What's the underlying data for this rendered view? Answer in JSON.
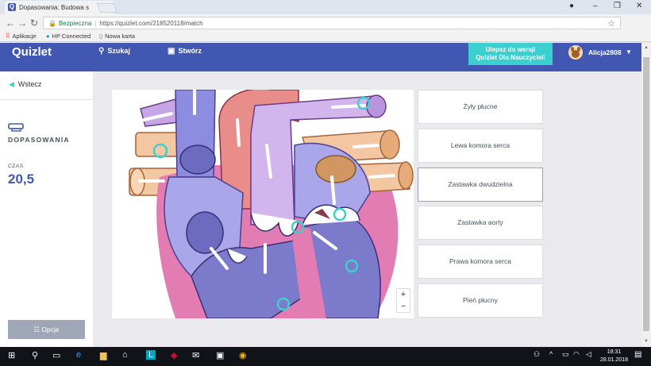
{
  "browser": {
    "tab_title": "Dopasowania: Budowa s",
    "tab_close": "×",
    "secure_label": "Bezpieczna",
    "url": "https://quizlet.com/218520118/match",
    "bookmarks": [
      "Aplikacje",
      "HP Connected",
      "Nowa karta"
    ]
  },
  "header": {
    "logo": "Quizlet",
    "search_label": "Szukaj",
    "create_label": "Stwórz",
    "upgrade_line1": "Ulepsz do wersji",
    "upgrade_line2": "Quizlet Dla Nauczycieli",
    "username": "Alicja2808"
  },
  "sidebar": {
    "back_label": "Wstecz",
    "mode_label": "DOPASOWANIA",
    "time_label": "CZAS",
    "time_value": "20,5",
    "options_label": "Opcje"
  },
  "zoom": {
    "plus": "+",
    "minus": "−"
  },
  "terms": [
    "Żyły płucne",
    "Lewa komora serca",
    "Zastawka dwudzielna",
    "Zastawka aorty",
    "Prawa komora serca",
    "Pień płucny"
  ],
  "taskbar": {
    "time": "18:31",
    "date": "28.01.2018"
  },
  "colors": {
    "brand": "#4257b2",
    "accent": "#3ccfcf"
  }
}
